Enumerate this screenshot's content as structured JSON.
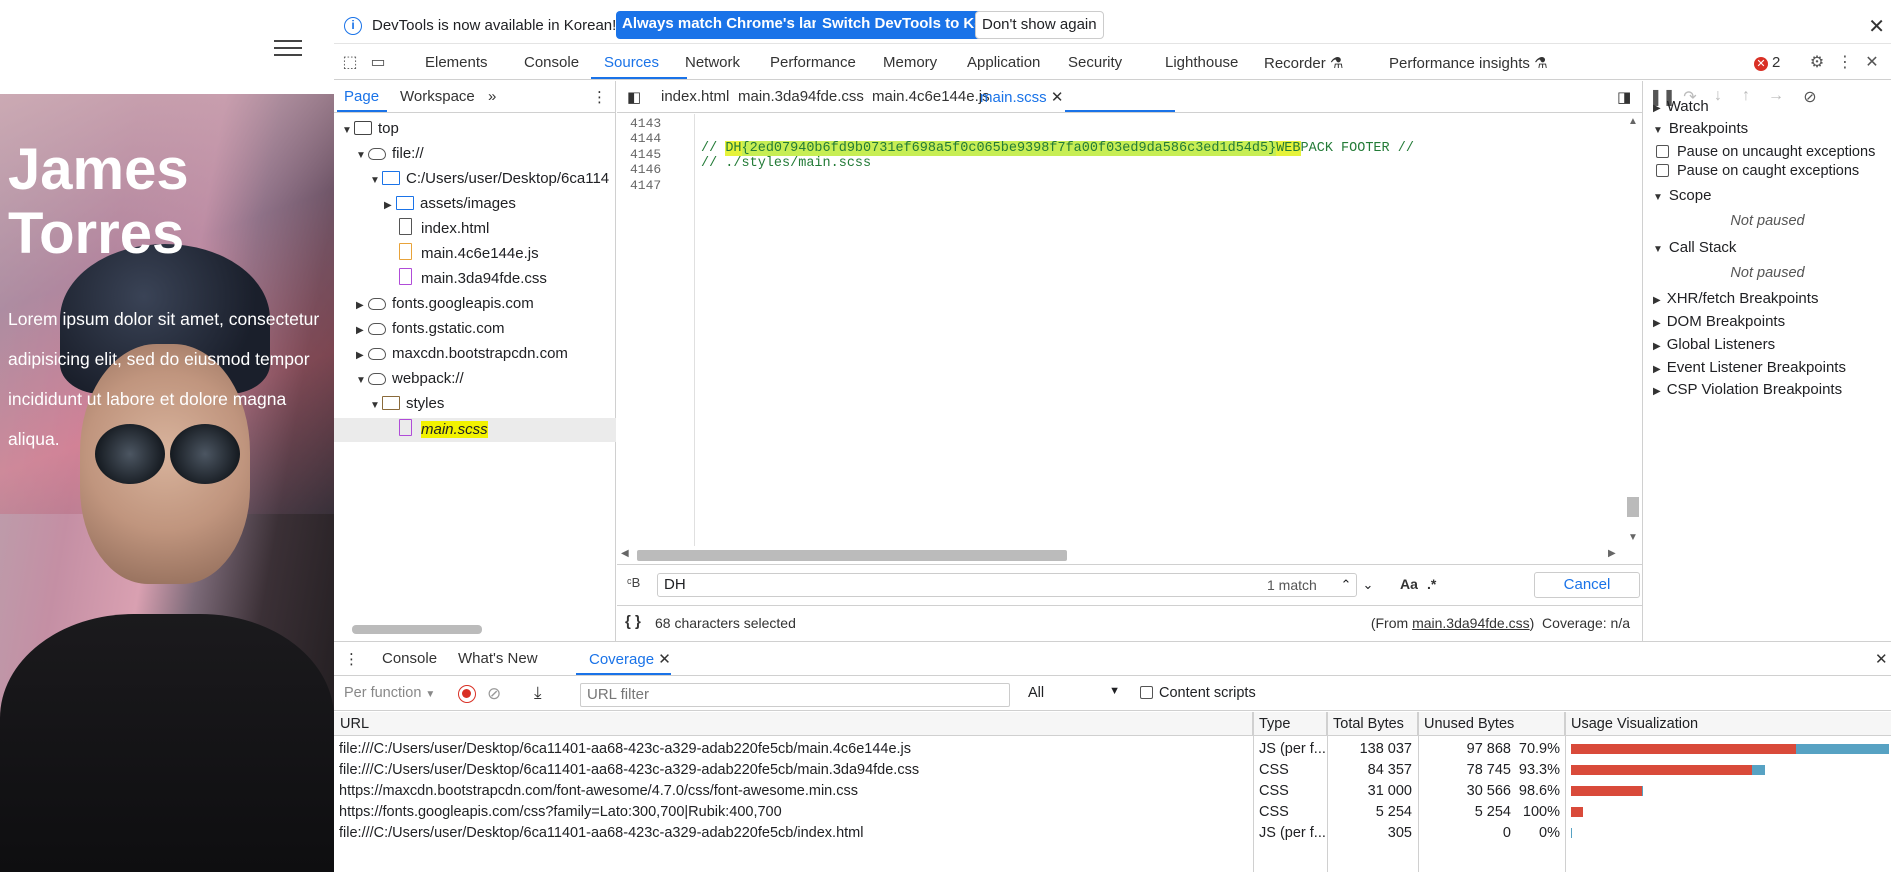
{
  "site": {
    "title_line1": "James",
    "title_line2": "Torres",
    "paragraph": "Lorem ipsum dolor sit amet, consectetur adipisicing elit, sed do eiusmod tempor incididunt ut labore et dolore magna aliqua."
  },
  "infobar": {
    "text": "DevTools is now available in Korean!",
    "btn_match": "Always match Chrome's language",
    "btn_switch": "Switch DevTools to Korean",
    "btn_dismiss": "Don't show again"
  },
  "main_tabs": [
    "Elements",
    "Console",
    "Sources",
    "Network",
    "Performance",
    "Memory",
    "Application",
    "Security",
    "Lighthouse",
    "Recorder",
    "Performance insights"
  ],
  "error_count": "2",
  "navigator": {
    "tabs": [
      "Page",
      "Workspace"
    ],
    "tree": [
      {
        "label": "top",
        "icon": "frame-icon"
      },
      {
        "label": "file://",
        "icon": "cloud-icon"
      },
      {
        "label": "C:/Users/user/Desktop/6ca114",
        "icon": "folder-icon"
      },
      {
        "label": "assets/images",
        "icon": "folder-icon"
      },
      {
        "label": "index.html",
        "icon": "file-icon"
      },
      {
        "label": "main.4c6e144e.js",
        "icon": "file-js-icon"
      },
      {
        "label": "main.3da94fde.css",
        "icon": "file-css-icon"
      },
      {
        "label": "fonts.googleapis.com",
        "icon": "cloud-icon"
      },
      {
        "label": "fonts.gstatic.com",
        "icon": "cloud-icon"
      },
      {
        "label": "maxcdn.bootstrapcdn.com",
        "icon": "cloud-icon"
      },
      {
        "label": "webpack://",
        "icon": "cloud-icon"
      },
      {
        "label": "styles",
        "icon": "folder-icon"
      },
      {
        "label": "main.scss",
        "icon": "file-scss-icon"
      }
    ]
  },
  "editor": {
    "tabs": [
      "index.html",
      "main.3da94fde.css",
      "main.4c6e144e.js",
      "main.scss"
    ],
    "lines": [
      {
        "n": "4143",
        "text": ""
      },
      {
        "n": "4144",
        "text": ""
      },
      {
        "n": "4145",
        "text": ""
      },
      {
        "n": "4146",
        "pre": "// ",
        "hl1": "DH",
        "hl2": "{2ed07940b6fd9b0731ef698a5f0c065be9398f7fa00f03ed9da586c3ed1d54d5}",
        "hl3": "WEB",
        "post": "PACK FOOTER //"
      },
      {
        "n": "4147",
        "text": "// ./styles/main.scss"
      }
    ],
    "search_value": "DH",
    "search_count": "1 match",
    "case_label": "Aa",
    "regex_label": ".*",
    "cancel_label": "Cancel",
    "status_selected": "68 characters selected",
    "status_from_prefix": "(From ",
    "status_from_file": "main.3da94fde.css",
    "status_from_suffix": ")",
    "status_coverage": "Coverage: n/a"
  },
  "debugger": {
    "watch": "Watch",
    "breakpoints": "Breakpoints",
    "pause_uncaught": "Pause on uncaught exceptions",
    "pause_caught": "Pause on caught exceptions",
    "scope": "Scope",
    "not_paused_1": "Not paused",
    "call_stack": "Call Stack",
    "not_paused_2": "Not paused",
    "xhr": "XHR/fetch Breakpoints",
    "dom": "DOM Breakpoints",
    "global": "Global Listeners",
    "event": "Event Listener Breakpoints",
    "csp": "CSP Violation Breakpoints"
  },
  "drawer": {
    "tabs": [
      "Console",
      "What's New",
      "Coverage"
    ],
    "per_function": "Per function",
    "url_filter_placeholder": "URL filter",
    "type_select": "All",
    "content_scripts": "Content scripts",
    "headers": [
      "URL",
      "Type",
      "Total Bytes",
      "Unused Bytes",
      "Usage Visualization"
    ],
    "rows": [
      {
        "url": "file:///C:/Users/user/Desktop/6ca11401-aa68-423c-a329-adab220fe5cb/main.4c6e144e.js",
        "type": "JS (per f...",
        "total": "138 037",
        "unused": "97 868",
        "pct": "70.9%",
        "unused_frac": 0.709,
        "size_frac": 1.0
      },
      {
        "url": "file:///C:/Users/user/Desktop/6ca11401-aa68-423c-a329-adab220fe5cb/main.3da94fde.css",
        "type": "CSS",
        "total": "84 357",
        "unused": "78 745",
        "pct": "93.3%",
        "unused_frac": 0.933,
        "size_frac": 0.611
      },
      {
        "url": "https://maxcdn.bootstrapcdn.com/font-awesome/4.7.0/css/font-awesome.min.css",
        "type": "CSS",
        "total": "31 000",
        "unused": "30 566",
        "pct": "98.6%",
        "unused_frac": 0.986,
        "size_frac": 0.225
      },
      {
        "url": "https://fonts.googleapis.com/css?family=Lato:300,700|Rubik:400,700",
        "type": "CSS",
        "total": "5 254",
        "unused": "5 254",
        "pct": "100%",
        "unused_frac": 1.0,
        "size_frac": 0.038
      },
      {
        "url": "file:///C:/Users/user/Desktop/6ca11401-aa68-423c-a329-adab220fe5cb/index.html",
        "type": "JS (per f...",
        "total": "305",
        "unused": "0",
        "pct": "0%",
        "unused_frac": 0.0,
        "size_frac": 0.0022
      }
    ]
  },
  "colors": {
    "accent": "#1a73e8",
    "unused_bar": "#d94a3a",
    "used_bar": "#57a2c3",
    "highlight": "#f2f200"
  }
}
